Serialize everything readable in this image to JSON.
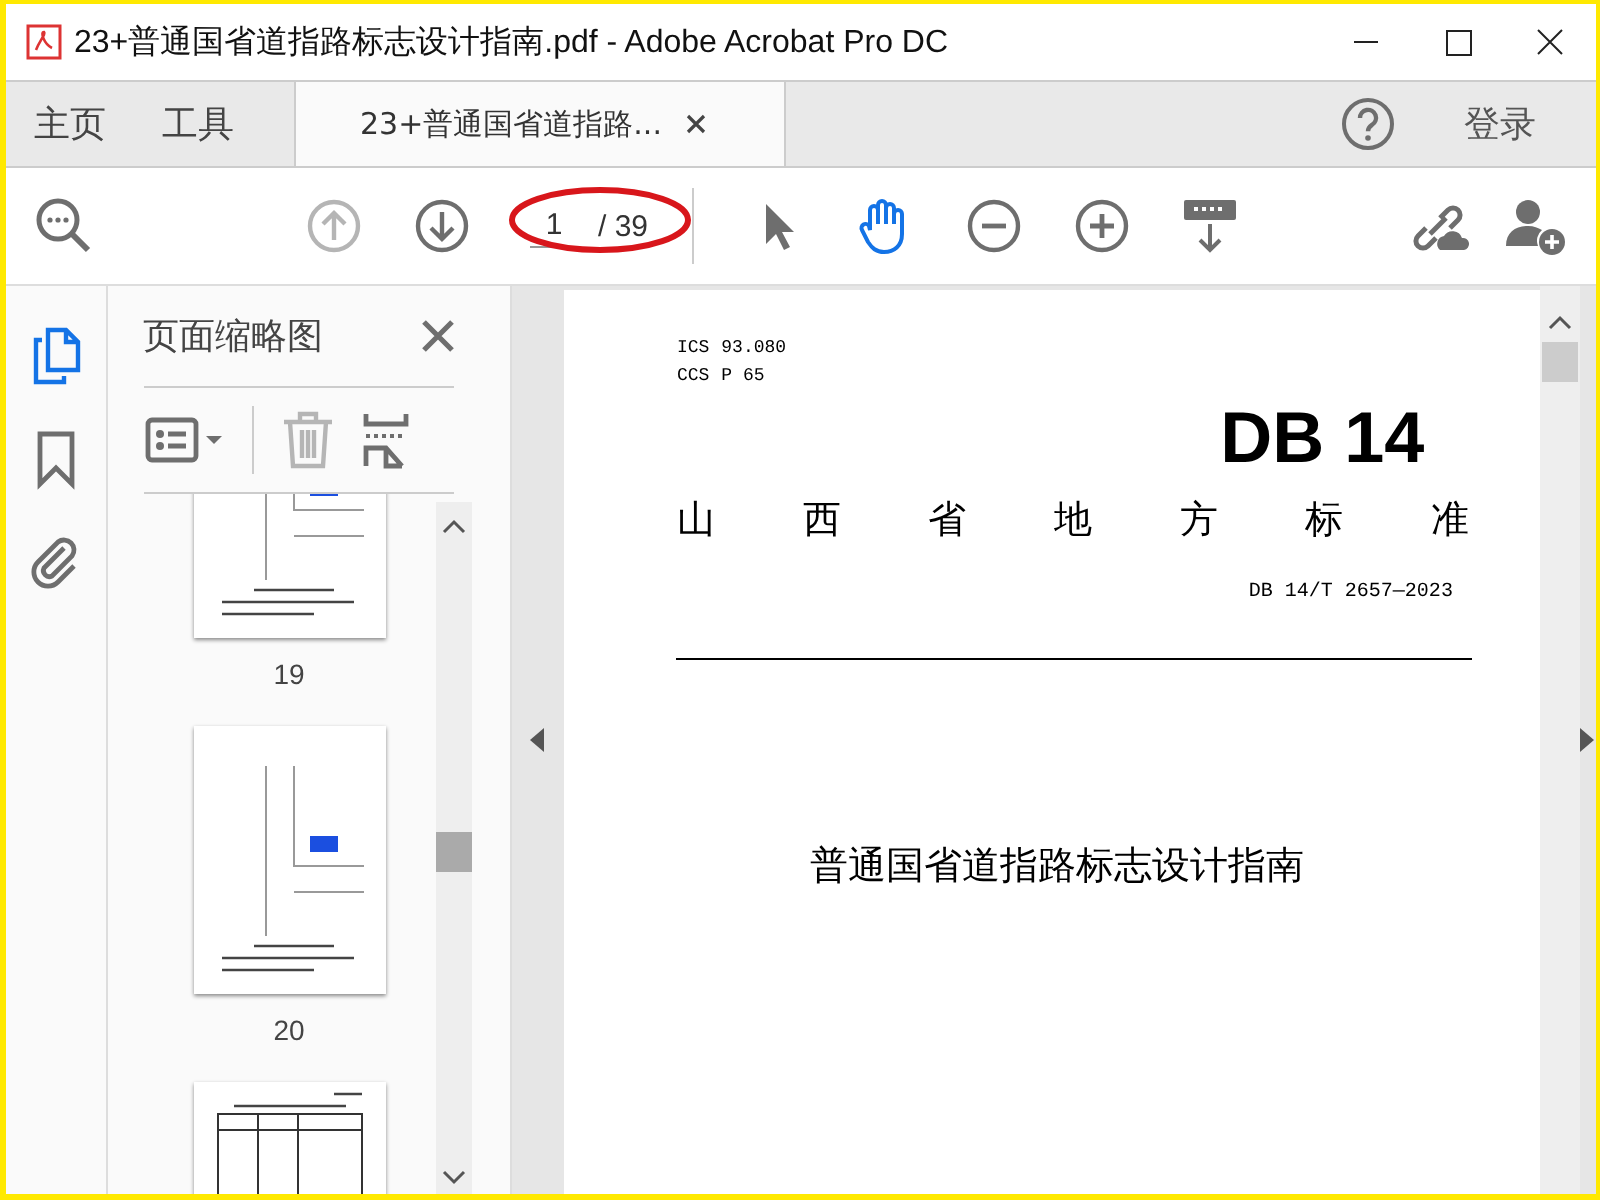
{
  "window": {
    "title": "23+普通国省道指路标志设计指南.pdf - Adobe Acrobat Pro DC"
  },
  "nav_tabs": [
    {
      "label": "主页",
      "selected": false
    },
    {
      "label": "工具",
      "selected": false
    }
  ],
  "document_tab": {
    "label": "23+普通国省道指路...",
    "selected": true
  },
  "sign_in": "登录",
  "toolbar": {
    "nav": [
      {
        "kind": "up",
        "disabled": true
      },
      {
        "kind": "down",
        "disabled": false
      }
    ],
    "page": {
      "value": "1",
      "total": "/ 39"
    },
    "tools": [
      {
        "kind": "select",
        "selected": false
      },
      {
        "kind": "hand",
        "selected": true
      },
      {
        "kind": "zoom-out",
        "selected": false
      },
      {
        "kind": "zoom-in",
        "selected": false
      },
      {
        "kind": "scroll-mode",
        "selected": false
      }
    ]
  },
  "rail": [
    {
      "kind": "pages",
      "selected": true
    },
    {
      "kind": "bookmarks",
      "selected": false
    },
    {
      "kind": "attachments",
      "selected": false
    }
  ],
  "thumbnails_panel": {
    "title": "页面缩略图",
    "delete_disabled": true,
    "thumbnails": [
      {
        "kind": "diagram",
        "label": "19"
      },
      {
        "kind": "diagram",
        "label": "20"
      },
      {
        "kind": "table"
      }
    ]
  },
  "document": {
    "codes": [
      {
        "key": "ICS",
        "value": "93.080"
      },
      {
        "key": "CCS",
        "value": "P 65"
      }
    ],
    "mark": "DB 14",
    "authority": [
      "山",
      "西",
      "省",
      "地",
      "方",
      "标",
      "准"
    ],
    "number": "DB 14/T 2657—2023",
    "title": "普通国省道指路标志设计指南"
  }
}
